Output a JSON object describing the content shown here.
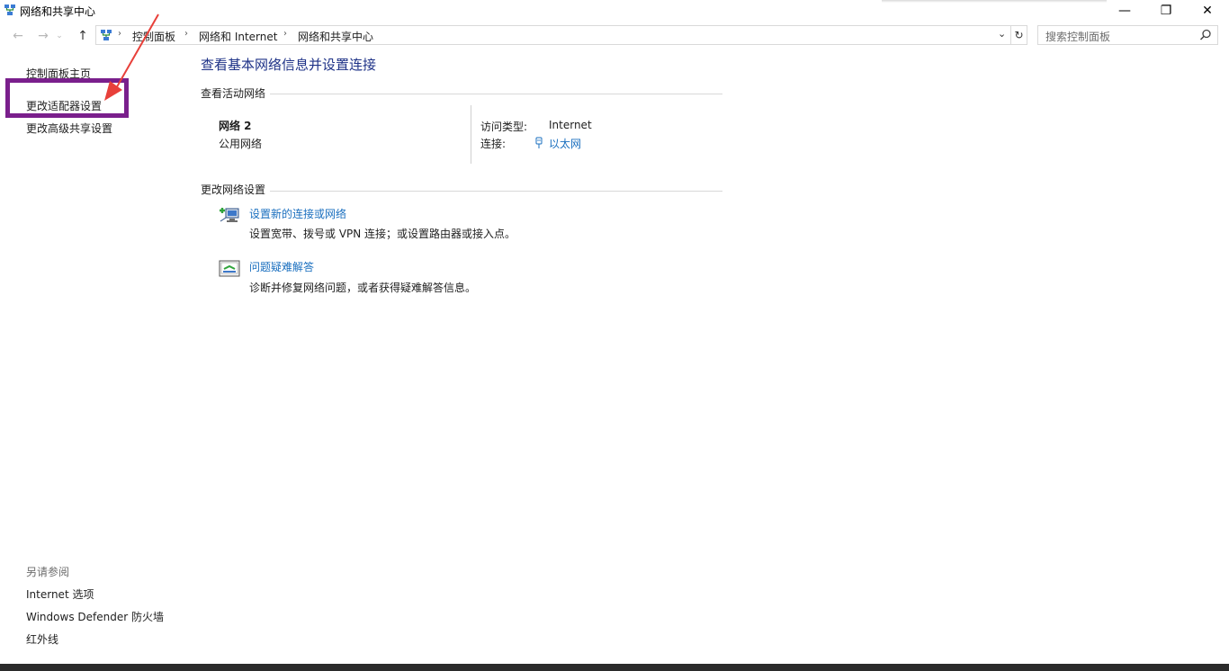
{
  "window": {
    "title": "网络和共享中心",
    "minimize_glyph": "—",
    "maximize_glyph": "❐",
    "close_glyph": "✕"
  },
  "navigation": {
    "back_glyph": "←",
    "forward_glyph": "→",
    "recent_glyph": "⌄",
    "up_glyph": "↑",
    "breadcrumb": [
      "控制面板",
      "网络和 Internet",
      "网络和共享中心"
    ],
    "separator": "›",
    "dropdown_glyph": "⌄",
    "refresh_glyph": "↻"
  },
  "search": {
    "placeholder": "搜索控制面板"
  },
  "sidebar": {
    "items": [
      {
        "label": "控制面板主页"
      },
      {
        "label": "更改适配器设置"
      },
      {
        "label": "更改高级共享设置"
      }
    ],
    "see_also_header": "另请参阅",
    "see_also": [
      {
        "label": "Internet 选项"
      },
      {
        "label": "Windows Defender 防火墙"
      },
      {
        "label": "红外线"
      }
    ]
  },
  "main": {
    "title": "查看基本网络信息并设置连接",
    "active_networks": {
      "header": "查看活动网络",
      "network_name": "网络 2",
      "network_category": "公用网络",
      "access_type_label": "访问类型:",
      "access_type_value": "Internet",
      "connection_label": "连接:",
      "connection_value": "以太网"
    },
    "change_settings": {
      "header": "更改网络设置",
      "tasks": [
        {
          "link": "设置新的连接或网络",
          "description": "设置宽带、拨号或 VPN 连接；或设置路由器或接入点。",
          "icon": "new-connection-icon"
        },
        {
          "link": "问题疑难解答",
          "description": "诊断并修复网络问题，或者获得疑难解答信息。",
          "icon": "troubleshoot-icon"
        }
      ]
    }
  },
  "colors": {
    "title_blue": "#1e3287",
    "link_blue": "#1a6fbf",
    "highlight_purple": "#7a1f8c",
    "arrow_red": "#e8403a"
  }
}
